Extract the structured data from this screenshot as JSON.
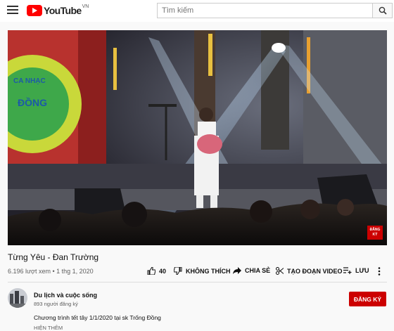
{
  "header": {
    "logo_text": "YouTube",
    "logo_country": "VN",
    "search_placeholder": "Tìm kiếm"
  },
  "video": {
    "title": "Từng Yêu - Đan Trường",
    "views": "6.196 lượt xem",
    "date": "1 thg 1, 2020",
    "meta_separator": " • ",
    "watermark_line1": "ĐĂNG",
    "watermark_line2": "KÝ",
    "stage_sign_line1": "CA NHẠC",
    "stage_sign_line2": "ĐỒNG"
  },
  "actions": {
    "like_count": "40",
    "dislike_label": "KHÔNG THÍCH",
    "share_label": "CHIA SẺ",
    "clip_label": "TẠO ĐOẠN VIDEO",
    "save_label": "LƯU"
  },
  "channel": {
    "name": "Du lịch và cuộc sống",
    "subscribers": "893 người đăng ký",
    "subscribe_label": "ĐĂNG KÝ"
  },
  "description": {
    "text": "Chương trình tết tây 1/1/2020 tại sk Trống Đồng",
    "show_more": "HIỆN THÊM"
  },
  "colors": {
    "brand_red": "#ff0000",
    "subscribe_red": "#cc0000"
  }
}
